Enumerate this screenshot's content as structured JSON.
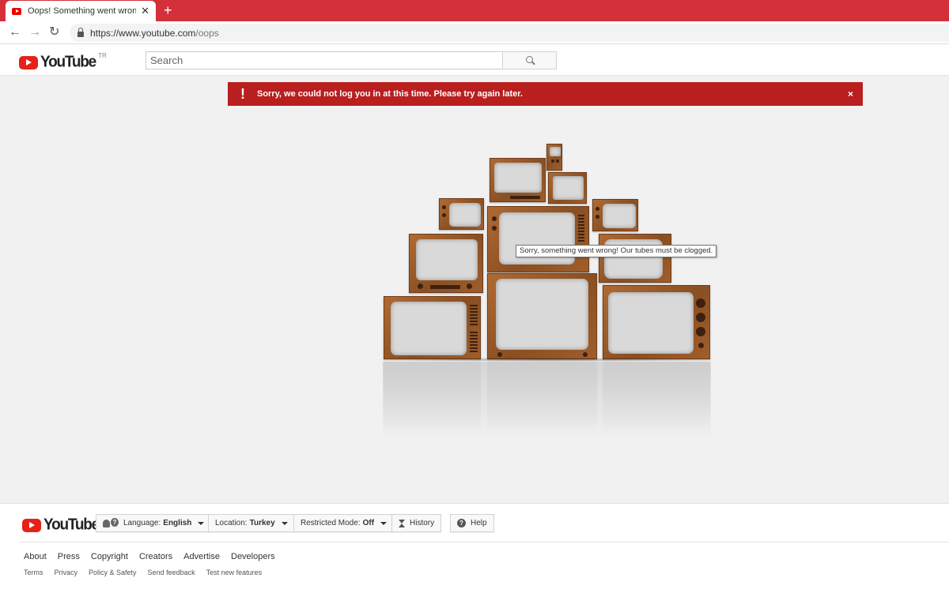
{
  "browser": {
    "tab_title": "Oops! Something went wrong. - YouTube",
    "tab_close": "✕",
    "new_tab": "+",
    "url_host": "https://www.youtube.com",
    "url_path": "/oops"
  },
  "header": {
    "logo_text": "YouTube",
    "region": "TR",
    "search_placeholder": "Search"
  },
  "alert": {
    "icon": "!",
    "message": "Sorry, we could not log you in at this time. Please try again later.",
    "close": "×"
  },
  "tooltip": {
    "text": "Sorry, something went wrong! Our tubes must be clogged."
  },
  "footer": {
    "logo_text": "YouTube",
    "language_label": "Language:",
    "language_value": "English",
    "location_label": "Location:",
    "location_value": "Turkey",
    "restricted_label": "Restricted Mode:",
    "restricted_value": "Off",
    "history_label": "History",
    "help_label": "Help",
    "primary_links": [
      "About",
      "Press",
      "Copyright",
      "Creators",
      "Advertise",
      "Developers"
    ],
    "secondary_links": [
      "Terms",
      "Privacy",
      "Policy & Safety",
      "Send feedback",
      "Test new features"
    ]
  },
  "colors": {
    "brand_red": "#e62117",
    "chrome_red": "#d3303a",
    "alert_red": "#b91f1f"
  },
  "icons": [
    "youtube-play-icon",
    "back-arrow-icon",
    "forward-arrow-icon",
    "reload-icon",
    "lock-icon",
    "search-icon",
    "exclamation-icon",
    "close-icon",
    "people-help-icon",
    "hourglass-icon",
    "help-icon",
    "caret-down-icon"
  ]
}
